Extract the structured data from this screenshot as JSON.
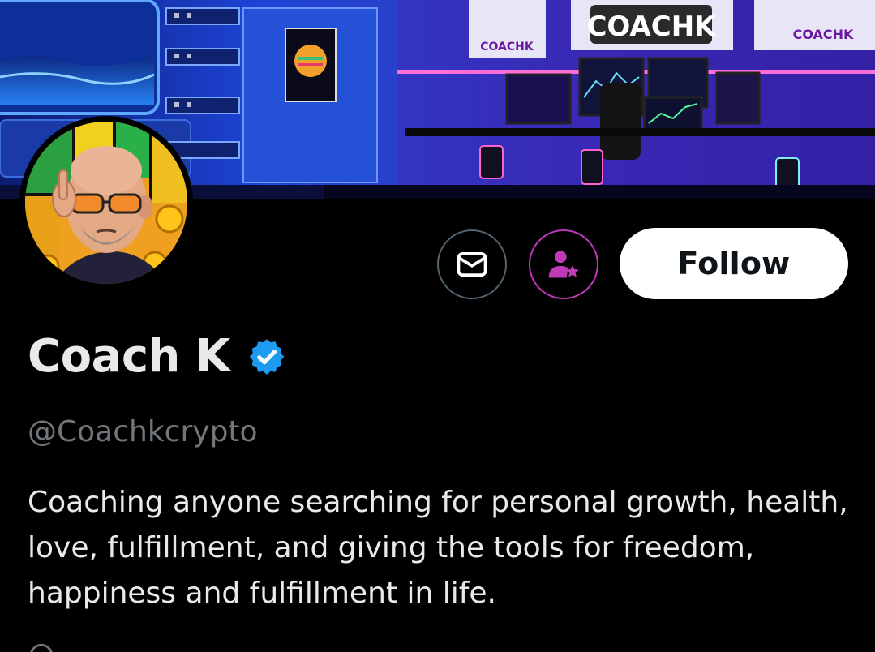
{
  "profile": {
    "display_name": "Coach K",
    "handle": "@Coachkcrypto",
    "bio": "Coaching anyone searching for personal growth, health, love, fulfillment, and giving the tools for freedom, happiness and fulfillment in life.",
    "verified_icon": "verified-badge-icon"
  },
  "banner": {
    "signs": {
      "main": "COACHK",
      "small_left": "COACHK",
      "small_right": "COACHK"
    }
  },
  "actions": {
    "message_icon": "envelope-icon",
    "subscribe_icon": "person-star-icon",
    "follow_label": "Follow"
  },
  "colors": {
    "background": "#000000",
    "primary_text": "#e7e9ea",
    "secondary_text": "#71767b",
    "verified_blue": "#1d9bf0",
    "subscribe_accent": "#c03ab8",
    "follow_bg": "#ffffff"
  }
}
